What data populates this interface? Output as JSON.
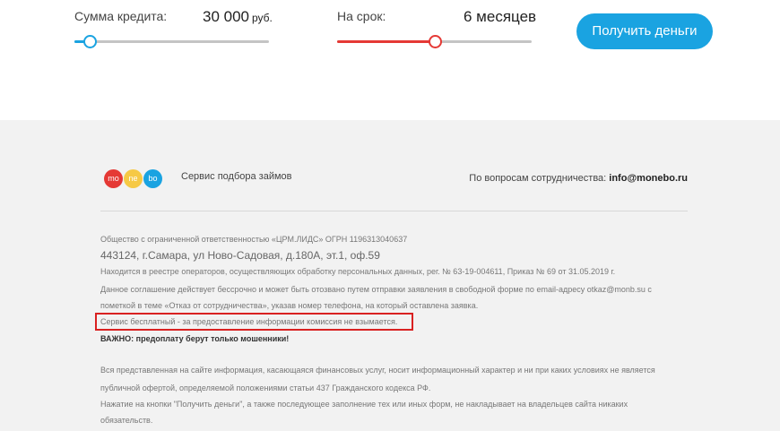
{
  "calculator": {
    "amount_label": "Сумма кредита:",
    "amount_value": "30 000",
    "amount_unit": "руб.",
    "amount_level": 0.08,
    "amount_color": "#1aa3e1",
    "term_label": "На срок:",
    "term_value": "6 месяцев",
    "term_level": 0.5,
    "term_color": "#e53935",
    "cta_label": "Получить деньги",
    "cta_color": "#1aa3e1"
  },
  "footer": {
    "logo": [
      {
        "text": "mo",
        "color": "#e53935"
      },
      {
        "text": "ne",
        "color": "#f6c945"
      },
      {
        "text": "bo",
        "color": "#1aa3e1"
      }
    ],
    "slogan": "Сервис подбора займов",
    "coop_label": "По вопросам сотрудничества:",
    "coop_email": "info@monebo.ru",
    "legal": {
      "company": "Общество с ограниченной ответственностью «ЦРМ.ЛИДС» ОГРН 1196313040637",
      "address": "443124, г.Самара, ул Ново-Садовая, д.180А, эт.1, оф.59",
      "registry": "Находится в реестре операторов, осуществляющих обработку персональных данных, рег. № 63-19-004611, Приказ № 69 от 31.05.2019 г.",
      "agreement_1": "Данное соглашение действует бессрочно и может быть отозвано путем отправки заявления в свободной форме по email-адресу otkaz@monb.su с",
      "agreement_2": "пометкой в теме «Отказ от сотрудничества», указав номер телефона, на который оставлена заявка.",
      "free_service": "Сервис бесплатный - за предоставление информации комиссия не взымается.",
      "warning": "ВАЖНО: предоплату берут только мошенники!",
      "info_1": "Вся представленная на сайте информация, касающаяся финансовых услуг, носит информационный характер и ни при каких условиях не является",
      "info_2": "публичной офертой, определяемой положениями статьи 437 Гражданского кодекса РФ.",
      "info_3": "Нажатие на кнопки \"Получить деньги\", а также последующее заполнение тех или иных форм, не накладывает на владельцев сайта никаких",
      "info_4": "обязательств."
    }
  }
}
